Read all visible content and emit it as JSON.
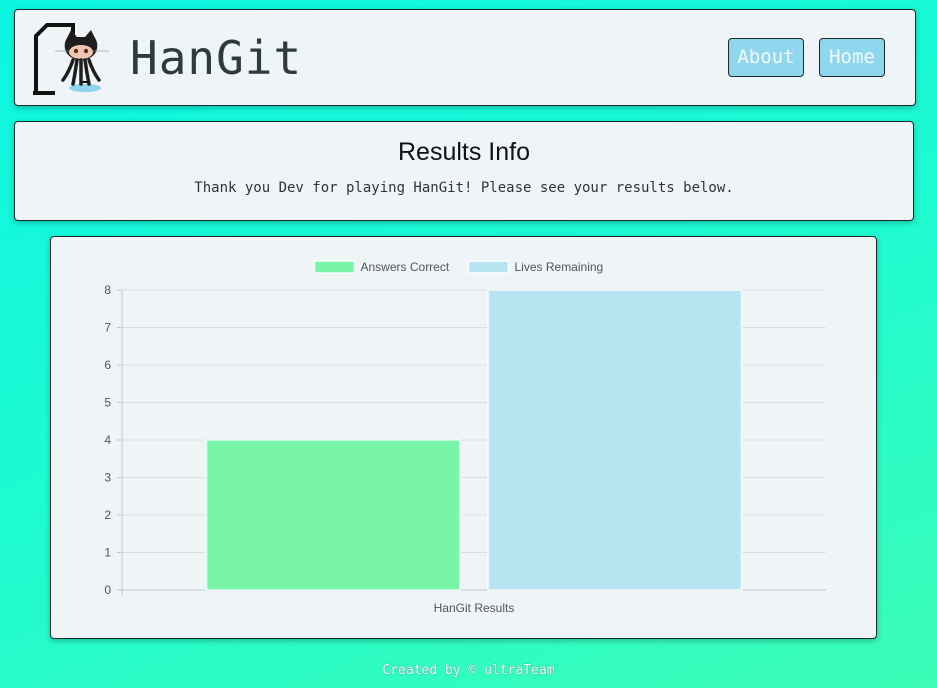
{
  "header": {
    "app_title": "HanGit",
    "nav": {
      "about_label": "About",
      "home_label": "Home"
    },
    "logo_icon": "hangman-octocat-icon"
  },
  "results": {
    "title": "Results Info",
    "message": "Thank you Dev for playing HanGit! Please see your results below."
  },
  "chart_data": {
    "type": "bar",
    "categories": [
      "HanGit Results"
    ],
    "series": [
      {
        "name": "Answers Correct",
        "values": [
          4
        ],
        "color": "#79f5a8"
      },
      {
        "name": "Lives Remaining",
        "values": [
          8
        ],
        "color": "#b8e4f2"
      }
    ],
    "ylim": [
      0,
      8
    ],
    "yticks": [
      "0",
      "1",
      "2",
      "3",
      "4",
      "5",
      "6",
      "7",
      "8"
    ],
    "grid": true,
    "legend": "top-center"
  },
  "footer": {
    "text": "Created by © ultraTeam"
  }
}
